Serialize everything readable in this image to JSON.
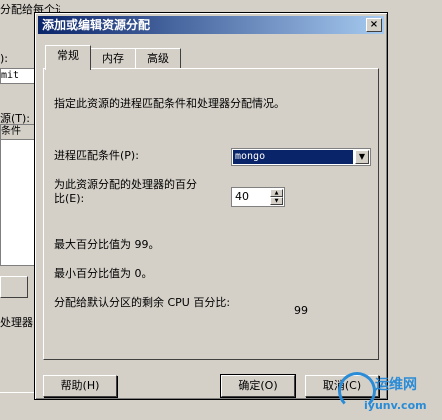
{
  "background": {
    "top_text": "分配给每个进程匹配条件。",
    "label1": "):",
    "input_value": "mit",
    "label2": "源(T):",
    "list_header": "条件",
    "bottom_text": "处理器"
  },
  "dialog": {
    "title": "添加或编辑资源分配",
    "close_glyph": "×",
    "tabs": [
      "常规",
      "内存",
      "高级"
    ],
    "description": "指定此资源的进程匹配条件和处理器分配情况。",
    "match_label": "进程匹配条件(P):",
    "match_value": "mongo",
    "percent_label_line1": "为此资源分配的处理器的百分",
    "percent_label_line2": "比(E):",
    "percent_value": "40",
    "max_text": "最大百分比值为 99。",
    "min_text": "最小百分比值为 0。",
    "remaining_label": "分配给默认分区的剩余 CPU 百分比:",
    "remaining_value": "99",
    "buttons": {
      "help": "帮助(H)",
      "ok": "确定(O)",
      "cancel": "取消(C)"
    }
  },
  "watermark": {
    "line1": "运维网",
    "line2": "iyunv.com"
  },
  "colors": {
    "title_bar": "#0a246a",
    "face": "#d4d0c8",
    "selection": "#0a246a",
    "watermark": "#2a8bd6"
  }
}
